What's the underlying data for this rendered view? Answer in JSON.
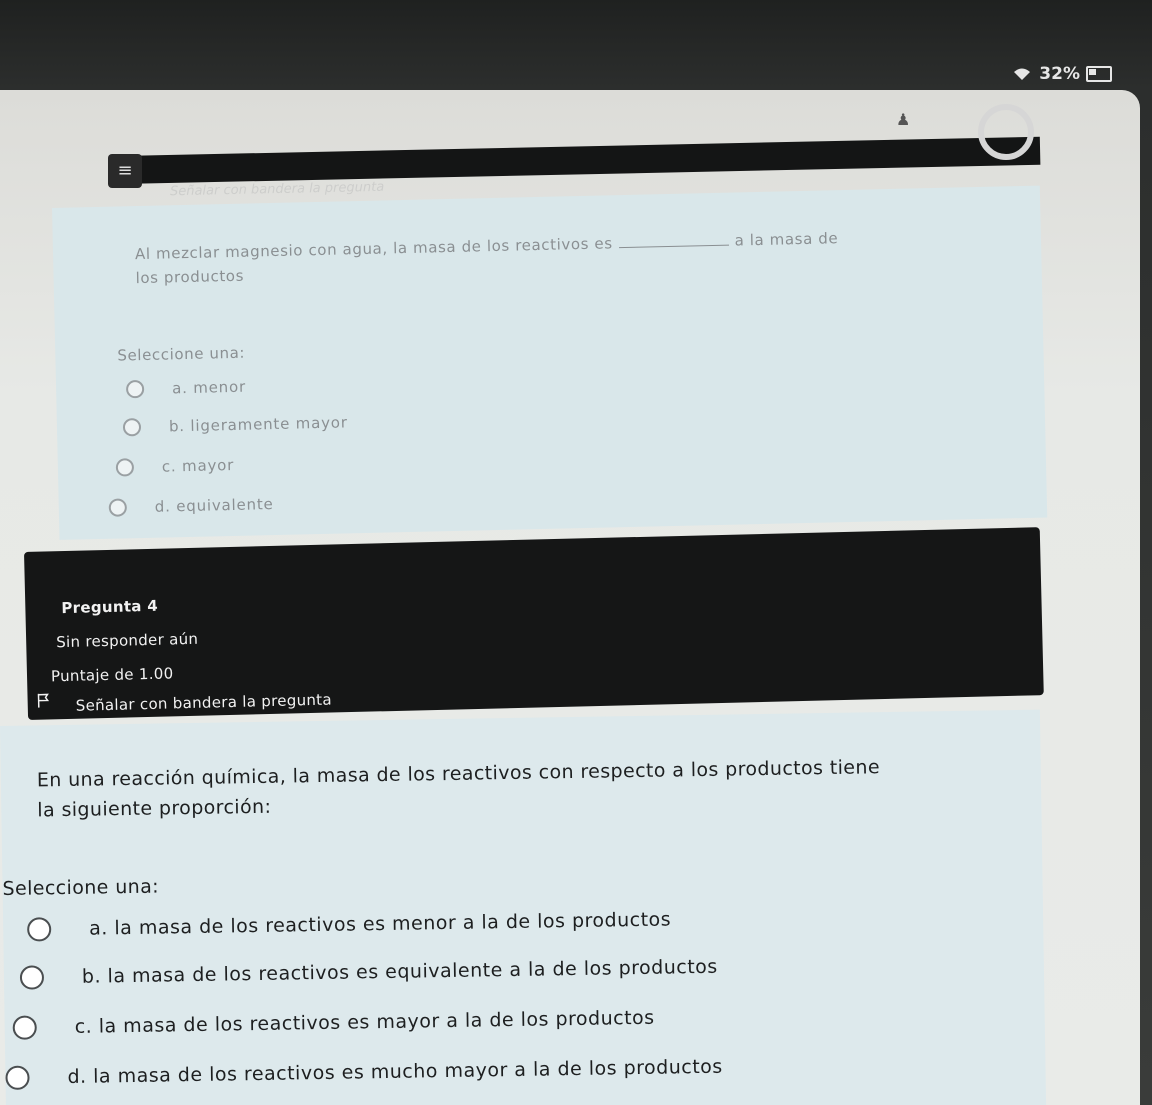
{
  "status": {
    "battery": "32%"
  },
  "previous_question": {
    "header_text": "Señalar con bandera la pregunta",
    "text_before_blank": "Al mezclar magnesio con agua, la masa de los reactivos es",
    "text_after_blank_1": "a la masa de",
    "text_after_blank_2": "los productos",
    "select_label": "Seleccione una:",
    "options": [
      {
        "label": "a. menor"
      },
      {
        "label": "b. ligeramente mayor"
      },
      {
        "label": "c. mayor"
      },
      {
        "label": "d. equivalente"
      }
    ]
  },
  "question_info": {
    "title": "Pregunta 4",
    "status": "Sin responder aún",
    "score": "Puntaje de 1.00",
    "flag_label": "Señalar con bandera la pregunta"
  },
  "question": {
    "text_line_1": "En una reacción química, la masa de los reactivos con respecto a los productos tiene",
    "text_line_2": "la siguiente proporción:",
    "select_label": "Seleccione una:",
    "options": [
      {
        "label": "a. la masa de los reactivos es menor a la de los productos"
      },
      {
        "label": "b. la masa de los reactivos es equivalente a la de los productos"
      },
      {
        "label": "c. la masa de los reactivos es mayor a la de los productos"
      },
      {
        "label": "d. la masa de los reactivos es mucho mayor a la de los productos"
      }
    ]
  }
}
